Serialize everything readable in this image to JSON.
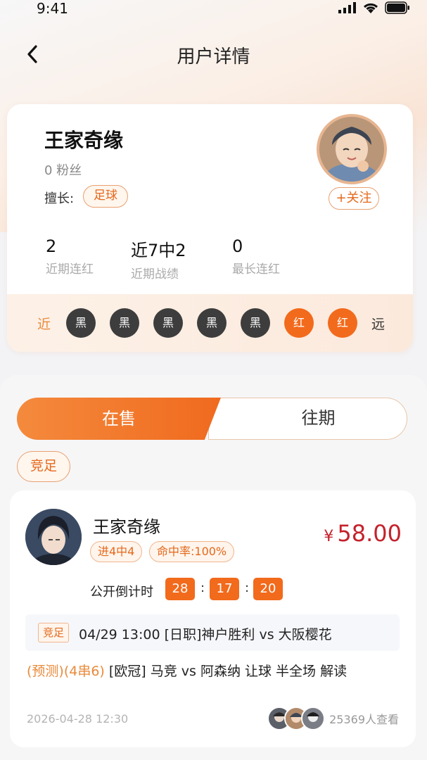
{
  "status_bar": {
    "time": "9:41"
  },
  "nav": {
    "title": "用户详情"
  },
  "profile": {
    "name": "王家奇缘",
    "fans": "0 粉丝",
    "skill_label": "擅长:",
    "skill_tag": "足球",
    "follow_label": "+关注",
    "stats": [
      {
        "value": "2",
        "label": "近期连红"
      },
      {
        "value": "近7中2",
        "label": "近期战绩"
      },
      {
        "value": "0",
        "label": "最长连红"
      }
    ],
    "streak": {
      "start_label": "近",
      "end_label": "远",
      "results": [
        "黑",
        "黑",
        "黑",
        "黑",
        "黑",
        "红",
        "红"
      ]
    }
  },
  "tabs": [
    {
      "label": "在售",
      "active": true
    },
    {
      "label": "往期",
      "active": false
    }
  ],
  "filter": {
    "label": "竞足"
  },
  "listing": {
    "name": "王家奇缘",
    "badges": [
      "进4中4",
      "命中率:100%"
    ],
    "price_symbol": "¥",
    "price": "58.00",
    "countdown_label": "公开倒计时",
    "countdown": [
      "28",
      "17",
      "20"
    ],
    "match_tag": "竞足",
    "match_text": "04/29 13:00 [日职]神户胜利 vs 大阪樱花",
    "desc_highlight": "(预测)(4串6)",
    "desc_text": " [欧冠] 马竞 vs 阿森纳 让球 半全场 解读",
    "post_time": "2026-04-28 12:30",
    "view_count": "25369人查看"
  },
  "colors": {
    "accent": "#f26a1b",
    "price": "#c4222c",
    "dot_black": "#3d3d3d"
  }
}
